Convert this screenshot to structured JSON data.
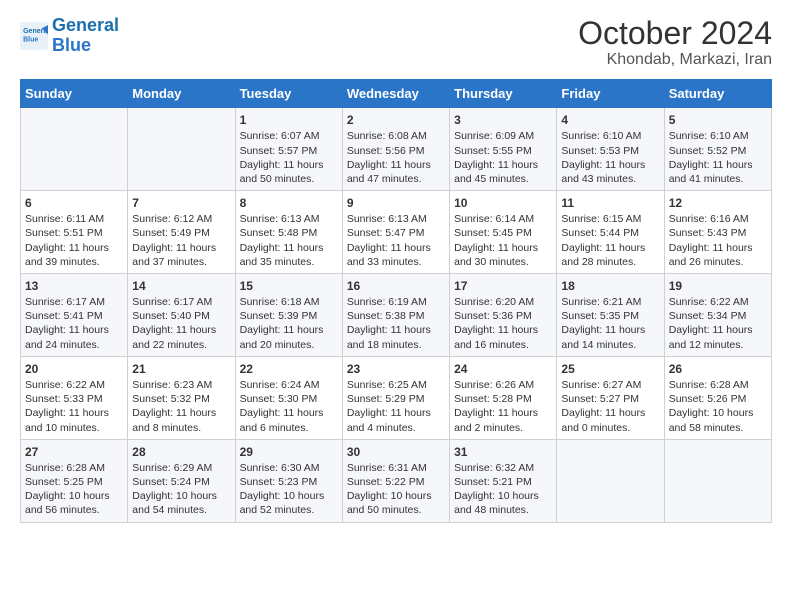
{
  "logo": {
    "line1": "General",
    "line2": "Blue"
  },
  "title": "October 2024",
  "subtitle": "Khondab, Markazi, Iran",
  "columns": [
    "Sunday",
    "Monday",
    "Tuesday",
    "Wednesday",
    "Thursday",
    "Friday",
    "Saturday"
  ],
  "weeks": [
    [
      {
        "day": "",
        "content": ""
      },
      {
        "day": "",
        "content": ""
      },
      {
        "day": "1",
        "content": "Sunrise: 6:07 AM\nSunset: 5:57 PM\nDaylight: 11 hours and 50 minutes."
      },
      {
        "day": "2",
        "content": "Sunrise: 6:08 AM\nSunset: 5:56 PM\nDaylight: 11 hours and 47 minutes."
      },
      {
        "day": "3",
        "content": "Sunrise: 6:09 AM\nSunset: 5:55 PM\nDaylight: 11 hours and 45 minutes."
      },
      {
        "day": "4",
        "content": "Sunrise: 6:10 AM\nSunset: 5:53 PM\nDaylight: 11 hours and 43 minutes."
      },
      {
        "day": "5",
        "content": "Sunrise: 6:10 AM\nSunset: 5:52 PM\nDaylight: 11 hours and 41 minutes."
      }
    ],
    [
      {
        "day": "6",
        "content": "Sunrise: 6:11 AM\nSunset: 5:51 PM\nDaylight: 11 hours and 39 minutes."
      },
      {
        "day": "7",
        "content": "Sunrise: 6:12 AM\nSunset: 5:49 PM\nDaylight: 11 hours and 37 minutes."
      },
      {
        "day": "8",
        "content": "Sunrise: 6:13 AM\nSunset: 5:48 PM\nDaylight: 11 hours and 35 minutes."
      },
      {
        "day": "9",
        "content": "Sunrise: 6:13 AM\nSunset: 5:47 PM\nDaylight: 11 hours and 33 minutes."
      },
      {
        "day": "10",
        "content": "Sunrise: 6:14 AM\nSunset: 5:45 PM\nDaylight: 11 hours and 30 minutes."
      },
      {
        "day": "11",
        "content": "Sunrise: 6:15 AM\nSunset: 5:44 PM\nDaylight: 11 hours and 28 minutes."
      },
      {
        "day": "12",
        "content": "Sunrise: 6:16 AM\nSunset: 5:43 PM\nDaylight: 11 hours and 26 minutes."
      }
    ],
    [
      {
        "day": "13",
        "content": "Sunrise: 6:17 AM\nSunset: 5:41 PM\nDaylight: 11 hours and 24 minutes."
      },
      {
        "day": "14",
        "content": "Sunrise: 6:17 AM\nSunset: 5:40 PM\nDaylight: 11 hours and 22 minutes."
      },
      {
        "day": "15",
        "content": "Sunrise: 6:18 AM\nSunset: 5:39 PM\nDaylight: 11 hours and 20 minutes."
      },
      {
        "day": "16",
        "content": "Sunrise: 6:19 AM\nSunset: 5:38 PM\nDaylight: 11 hours and 18 minutes."
      },
      {
        "day": "17",
        "content": "Sunrise: 6:20 AM\nSunset: 5:36 PM\nDaylight: 11 hours and 16 minutes."
      },
      {
        "day": "18",
        "content": "Sunrise: 6:21 AM\nSunset: 5:35 PM\nDaylight: 11 hours and 14 minutes."
      },
      {
        "day": "19",
        "content": "Sunrise: 6:22 AM\nSunset: 5:34 PM\nDaylight: 11 hours and 12 minutes."
      }
    ],
    [
      {
        "day": "20",
        "content": "Sunrise: 6:22 AM\nSunset: 5:33 PM\nDaylight: 11 hours and 10 minutes."
      },
      {
        "day": "21",
        "content": "Sunrise: 6:23 AM\nSunset: 5:32 PM\nDaylight: 11 hours and 8 minutes."
      },
      {
        "day": "22",
        "content": "Sunrise: 6:24 AM\nSunset: 5:30 PM\nDaylight: 11 hours and 6 minutes."
      },
      {
        "day": "23",
        "content": "Sunrise: 6:25 AM\nSunset: 5:29 PM\nDaylight: 11 hours and 4 minutes."
      },
      {
        "day": "24",
        "content": "Sunrise: 6:26 AM\nSunset: 5:28 PM\nDaylight: 11 hours and 2 minutes."
      },
      {
        "day": "25",
        "content": "Sunrise: 6:27 AM\nSunset: 5:27 PM\nDaylight: 11 hours and 0 minutes."
      },
      {
        "day": "26",
        "content": "Sunrise: 6:28 AM\nSunset: 5:26 PM\nDaylight: 10 hours and 58 minutes."
      }
    ],
    [
      {
        "day": "27",
        "content": "Sunrise: 6:28 AM\nSunset: 5:25 PM\nDaylight: 10 hours and 56 minutes."
      },
      {
        "day": "28",
        "content": "Sunrise: 6:29 AM\nSunset: 5:24 PM\nDaylight: 10 hours and 54 minutes."
      },
      {
        "day": "29",
        "content": "Sunrise: 6:30 AM\nSunset: 5:23 PM\nDaylight: 10 hours and 52 minutes."
      },
      {
        "day": "30",
        "content": "Sunrise: 6:31 AM\nSunset: 5:22 PM\nDaylight: 10 hours and 50 minutes."
      },
      {
        "day": "31",
        "content": "Sunrise: 6:32 AM\nSunset: 5:21 PM\nDaylight: 10 hours and 48 minutes."
      },
      {
        "day": "",
        "content": ""
      },
      {
        "day": "",
        "content": ""
      }
    ]
  ]
}
